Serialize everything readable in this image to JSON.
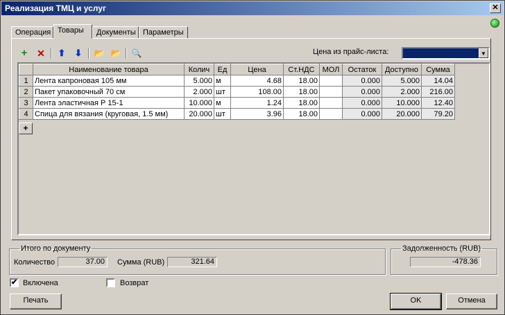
{
  "window": {
    "title": "Реализация ТМЦ и услуг",
    "close_glyph": "✕"
  },
  "tabs": [
    {
      "label": "Операция"
    },
    {
      "label": "Товары"
    },
    {
      "label": "Документы"
    },
    {
      "label": "Параметры"
    }
  ],
  "active_tab": "Товары",
  "toolbar": {
    "add_icon": "+",
    "delete_icon": "✕",
    "up_icon": "⬆",
    "down_icon": "⬇",
    "folder_remove_icon": "📂",
    "folder_add_icon": "📂",
    "search_icon": "🔍"
  },
  "price_list": {
    "label": "Цена из прайс-листа:",
    "value": ""
  },
  "grid": {
    "columns": [
      "",
      "Наименование товара",
      "Колич",
      "Ед",
      "Цена",
      "Ст.НДС",
      "МОЛ",
      "Остаток",
      "Доступно",
      "Сумма"
    ],
    "rows": [
      [
        "1",
        "Лента капроновая 105 мм",
        "5.000",
        "м",
        "4.68",
        "18.00",
        "",
        "0.000",
        "5.000",
        "14.04"
      ],
      [
        "2",
        "Пакет упаковочный 70 см",
        "2.000",
        "шт",
        "108.00",
        "18.00",
        "",
        "0.000",
        "2.000",
        "216.00"
      ],
      [
        "3",
        "Лента эластичная Р 15-1",
        "10.000",
        "м",
        "1.24",
        "18.00",
        "",
        "0.000",
        "10.000",
        "12.40"
      ],
      [
        "4",
        "Спица для вязания (круговая, 1.5 мм)",
        "20.000",
        "шт",
        "3.96",
        "18.00",
        "",
        "0.000",
        "20.000",
        "79.20"
      ]
    ],
    "add_row": "+"
  },
  "totals": {
    "legend": "Итого по документу",
    "qty_label": "Количество",
    "qty_value": "37.00",
    "sum_label": "Сумма (RUB)",
    "sum_value": "321.64"
  },
  "debt": {
    "legend": "Задолженность (RUB)",
    "value": "-478.36"
  },
  "checkboxes": {
    "enabled": {
      "label": "Включена",
      "checked": true,
      "mark": "✔"
    },
    "return": {
      "label": "Возврат",
      "checked": false
    }
  },
  "buttons": {
    "print": "Печать",
    "ok": "OK",
    "cancel": "Отмена"
  }
}
